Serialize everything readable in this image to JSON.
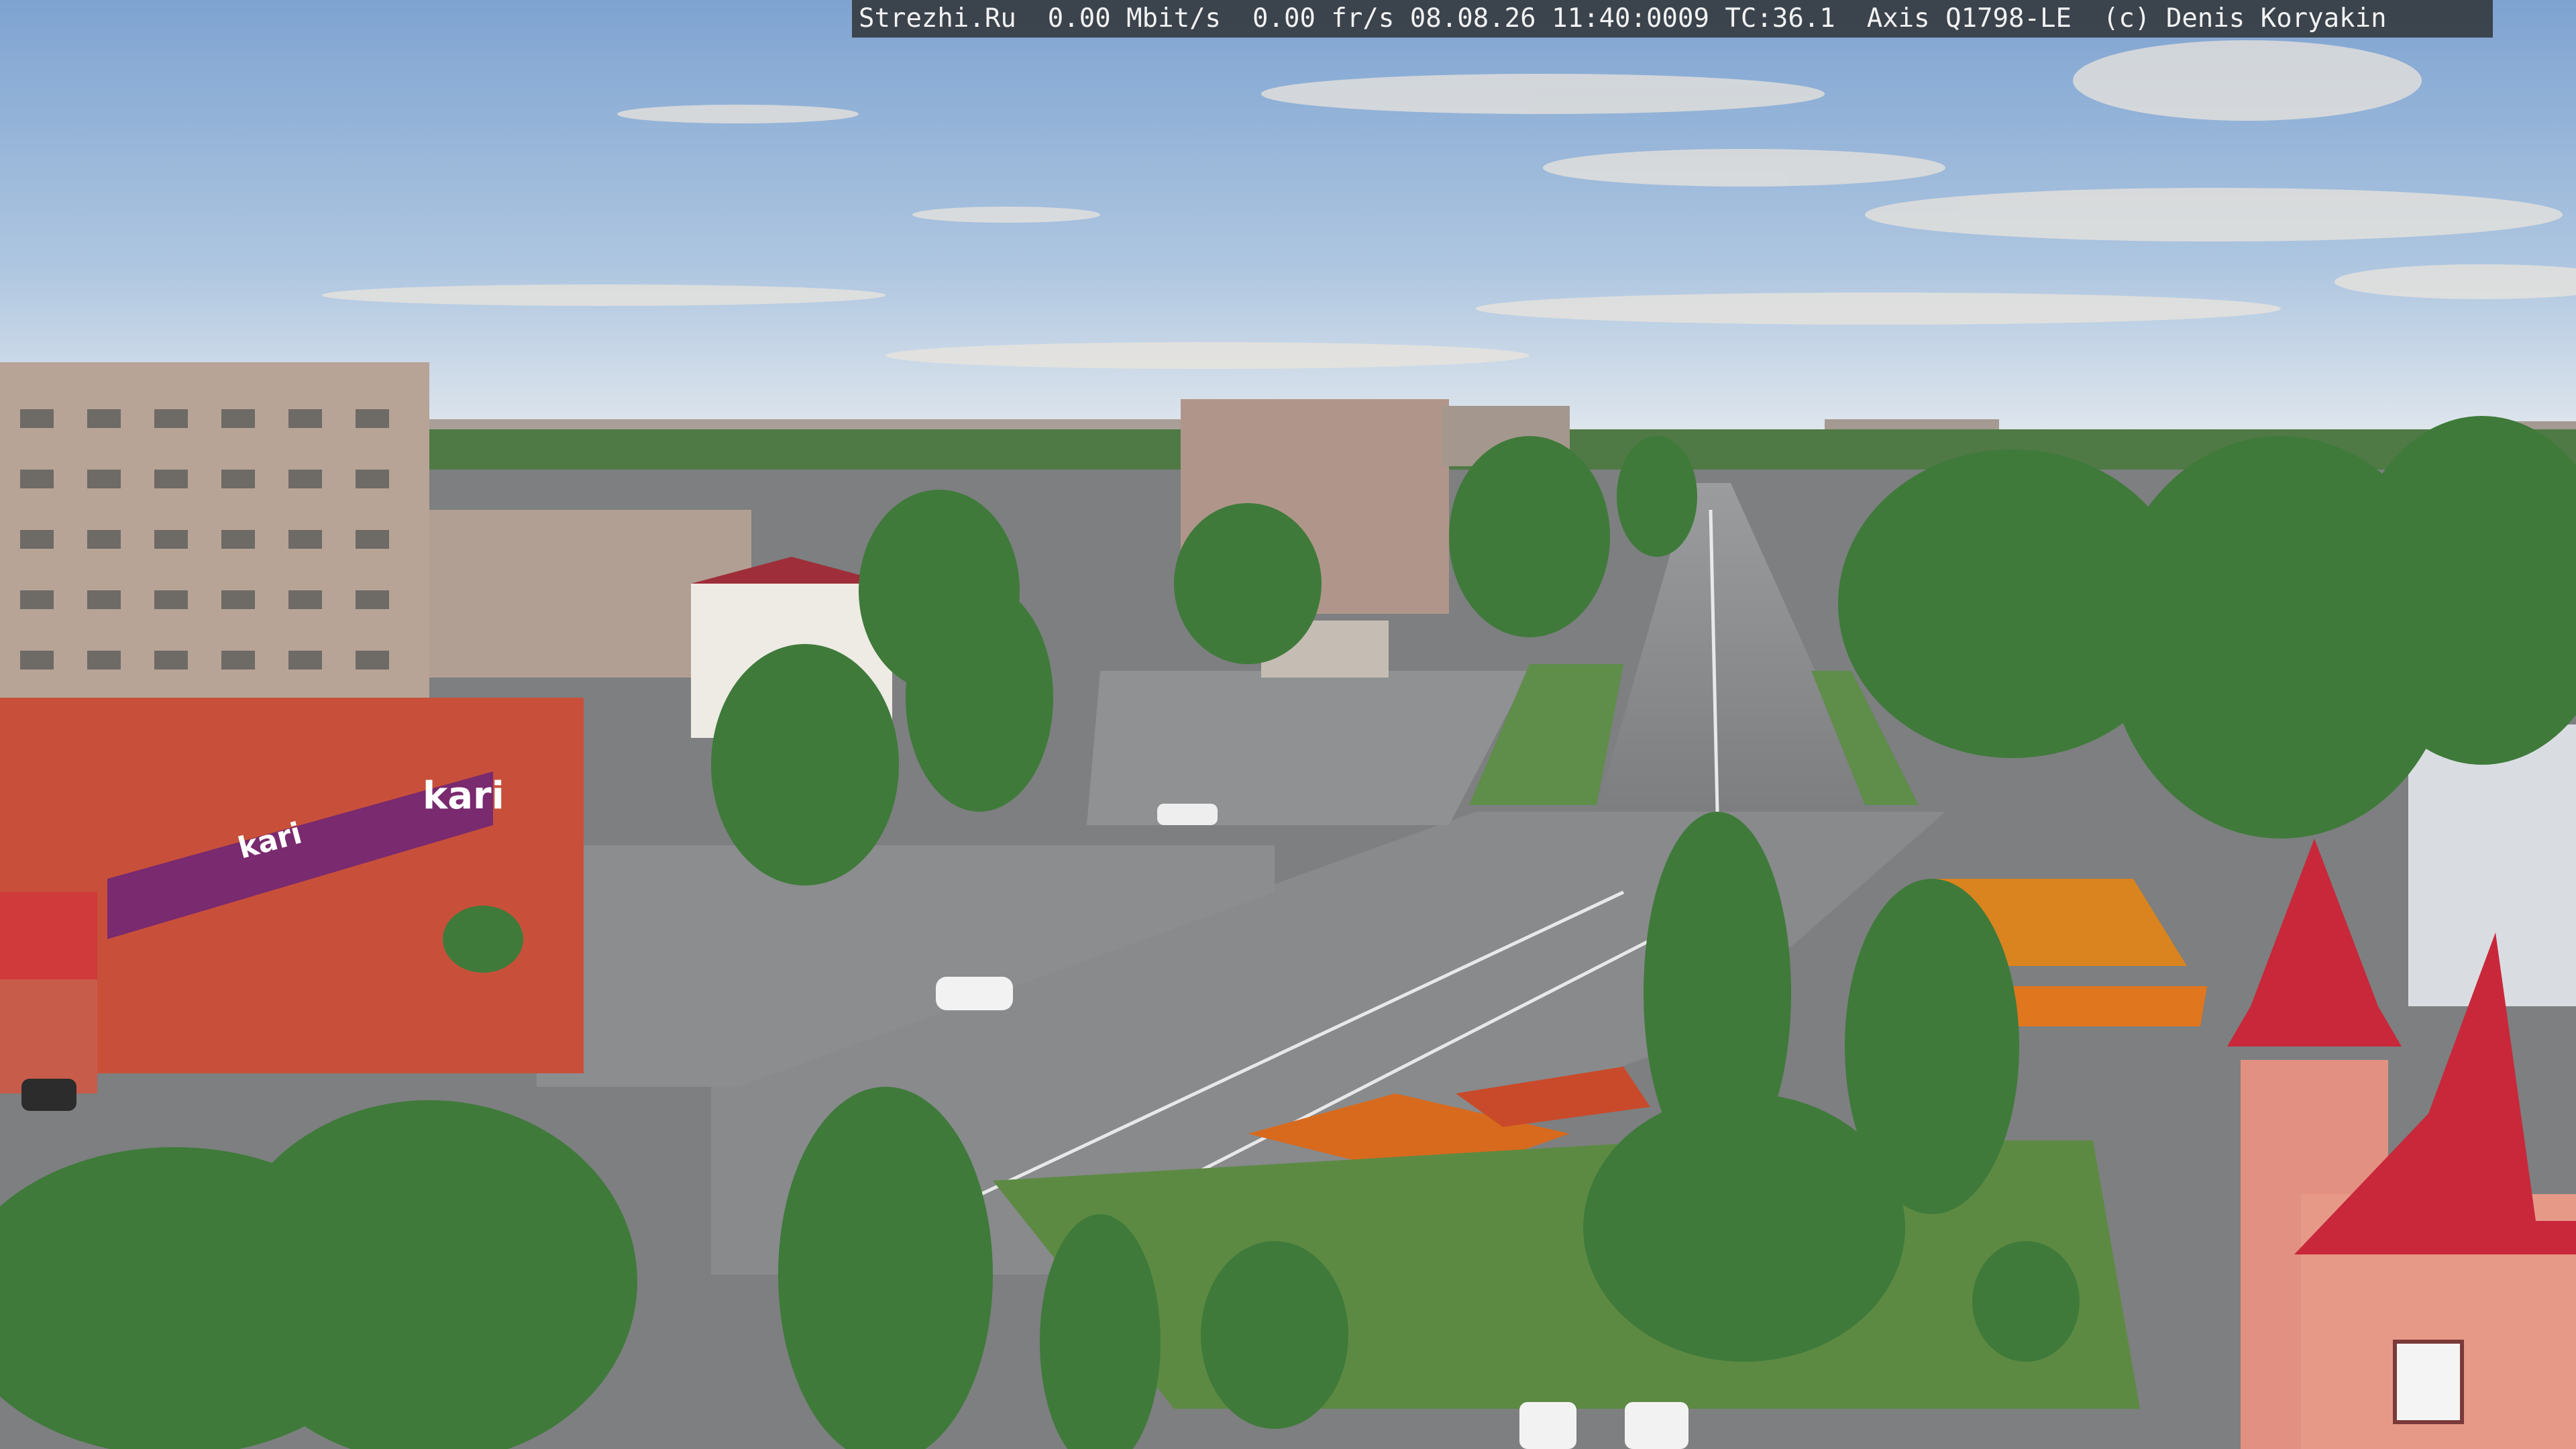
{
  "overlay": {
    "text": "Strezhi.Ru  0.00 Mbit/s  0.00 fr/s 08.08.26 11:40:0009 TC:36.1  Axis Q1798-LE  (c) Denis Koryakin"
  },
  "signs": {
    "store_brand": "kari",
    "store_brand_side": "kari"
  },
  "colors": {
    "sky_top": "#7fa4d2",
    "sky_bottom": "#dde6ee",
    "trees": "#3f7a3a",
    "asphalt": "#8e8e8e",
    "store_facade": "#c8503a",
    "store_banner": "#7a2a6e",
    "tower_roof": "#c8283a"
  }
}
